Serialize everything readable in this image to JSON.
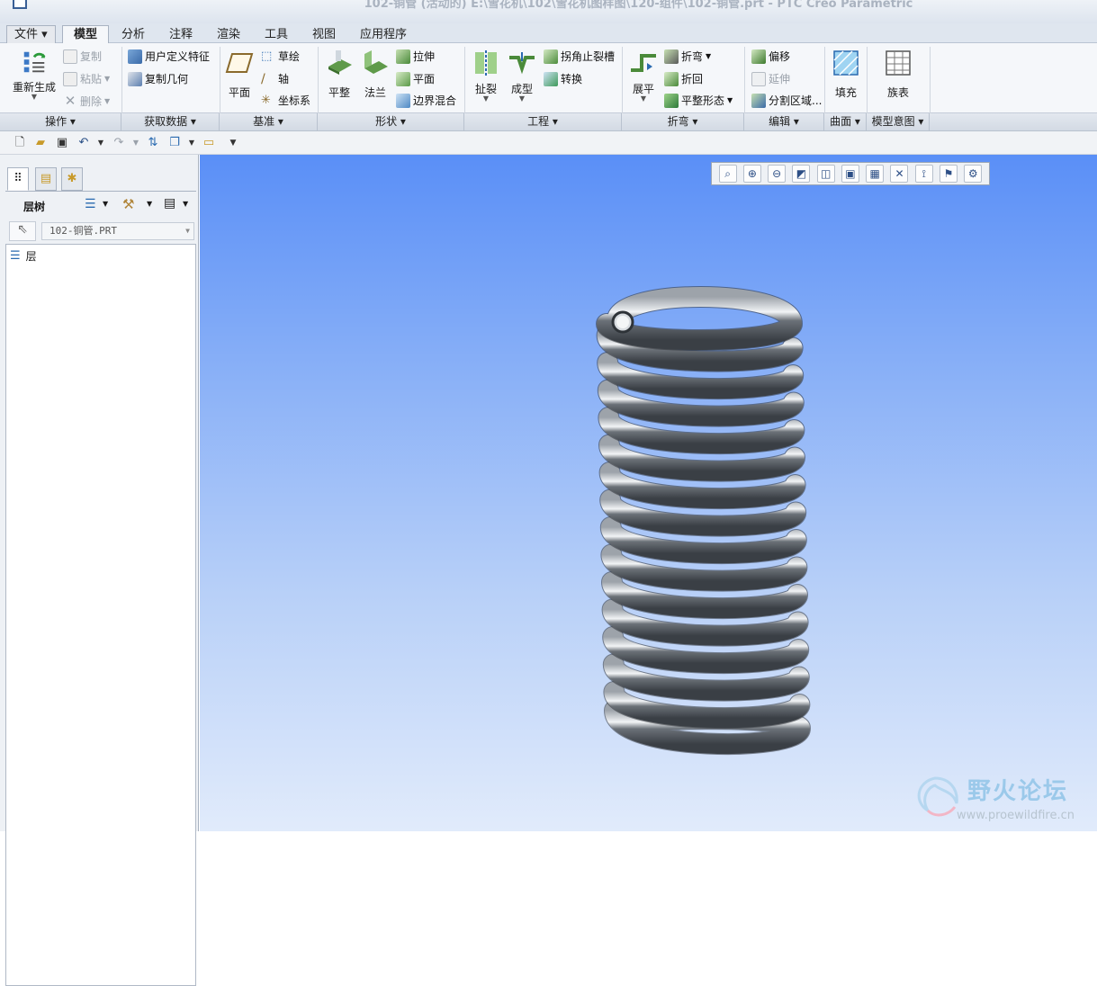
{
  "window": {
    "title": "102-铜管 (活动的) E:\\雪花机\\102\\雪花机图样图\\120-组件\\102-铜管.prt - PTC Creo Parametric"
  },
  "menu_tabs": [
    {
      "label": "文件 ▾"
    },
    {
      "label": "模型"
    },
    {
      "label": "分析"
    },
    {
      "label": "注释"
    },
    {
      "label": "渲染"
    },
    {
      "label": "工具"
    },
    {
      "label": "视图"
    },
    {
      "label": "应用程序"
    }
  ],
  "ribbon": {
    "operations": {
      "regenerate": "重新生成",
      "copy": "复制",
      "paste": "粘贴",
      "delete": "删除"
    },
    "get_data": {
      "udf": "用户定义特征",
      "copy_geometry": "复制几何"
    },
    "datum": {
      "plane": "平面",
      "sketch": "草绘",
      "axis": "轴",
      "csys": "坐标系"
    },
    "shapes": {
      "planar": "平整",
      "flange": "法兰",
      "extrude": "拉伸",
      "flat": "平面",
      "blend": "边界混合"
    },
    "engineering": {
      "rip": "扯裂",
      "form": "成型",
      "corner_relief": "拐角止裂槽",
      "convert": "转换"
    },
    "bends": {
      "unbend": "展平",
      "bend": "折弯",
      "bend_back": "折回",
      "flat_state": "平整形态"
    },
    "editing": {
      "offset": "偏移",
      "extend": "延伸",
      "split_area": "分割区域..."
    },
    "surfaces": {
      "fill": "填充"
    },
    "model_intent": {
      "family_table": "族表"
    }
  },
  "group_labels": [
    "操作 ▾",
    "获取数据 ▾",
    "基准 ▾",
    "形状 ▾",
    "工程 ▾",
    "折弯 ▾",
    "编辑 ▾",
    "曲面 ▾",
    "模型意图 ▾"
  ],
  "panel": {
    "layer_tree_label": "层树",
    "model_name": "102-铜管.PRT",
    "tree_items": [
      {
        "label": "层"
      }
    ]
  },
  "watermark": {
    "text": "野火论坛",
    "url": "www.proewildfire.cn"
  },
  "colors": {
    "viewport_top": "#5a8ff7",
    "viewport_bottom": "#e1ebfb",
    "coil": "#6b7178"
  }
}
